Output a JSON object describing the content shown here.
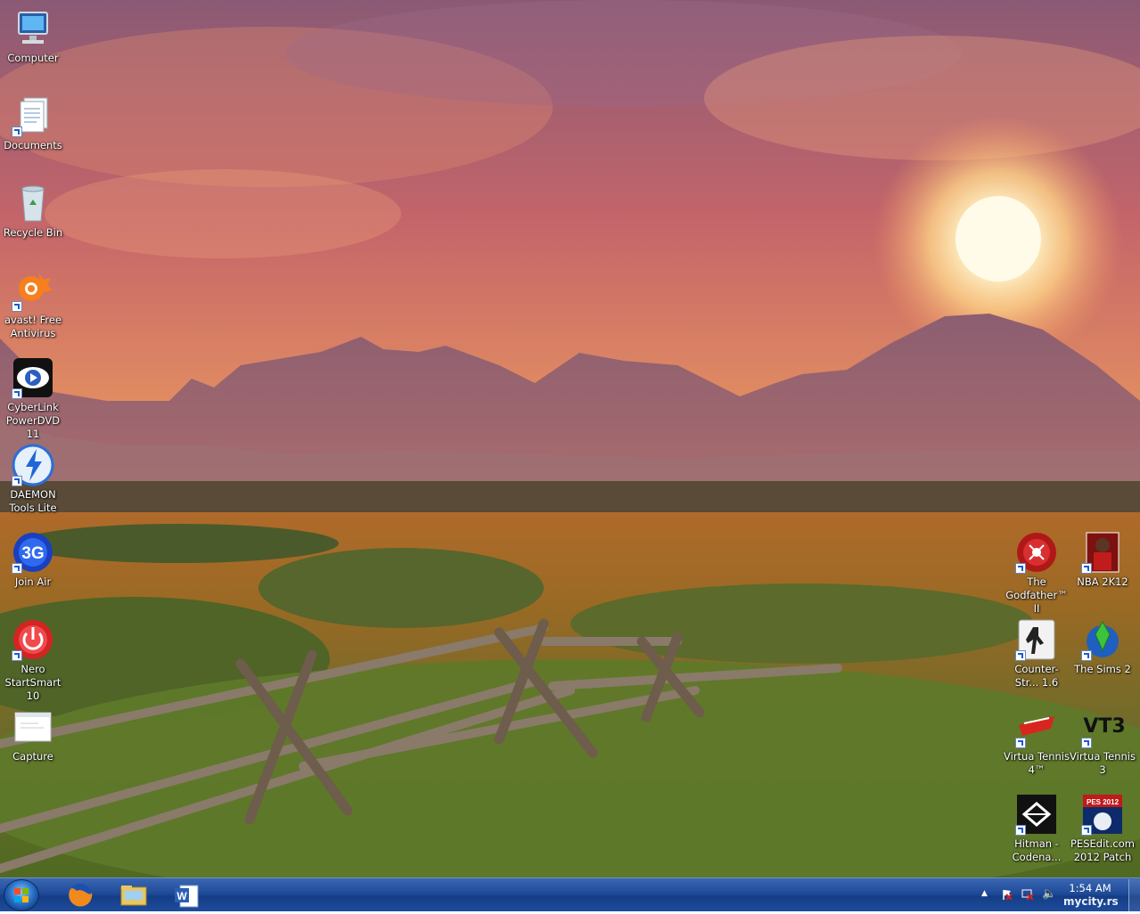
{
  "desktop_icons_left": [
    {
      "label": "Computer",
      "icon": "computer-icon"
    },
    {
      "label": "Documents",
      "icon": "documents-icon"
    },
    {
      "label": "Recycle Bin",
      "icon": "recycle-bin-icon"
    },
    {
      "label": "avast! Free Antivirus",
      "icon": "avast-icon"
    },
    {
      "label": "CyberLink PowerDVD 11",
      "icon": "powerdvd-icon"
    },
    {
      "label": "DAEMON Tools Lite",
      "icon": "daemon-tools-icon"
    },
    {
      "label": "Join Air",
      "icon": "join-air-icon"
    },
    {
      "label": "Nero StartSmart 10",
      "icon": "nero-icon"
    },
    {
      "label": "Capture",
      "icon": "capture-icon"
    }
  ],
  "desktop_icons_right": [
    {
      "label": "The Godfather™ II",
      "icon": "godfather-icon"
    },
    {
      "label": "NBA 2K12",
      "icon": "nba-2k12-icon"
    },
    {
      "label": "Counter-Str... 1.6",
      "icon": "counter-strike-icon"
    },
    {
      "label": "The Sims 2",
      "icon": "sims-2-icon"
    },
    {
      "label": "Virtua Tennis 4™",
      "icon": "virtua-tennis-4-icon"
    },
    {
      "label": "Virtua Tennis 3",
      "icon": "virtua-tennis-3-icon"
    },
    {
      "label": "Hitman - Codena...",
      "icon": "hitman-icon"
    },
    {
      "label": "PESEdit.com 2012 Patch",
      "icon": "pes-2012-icon"
    }
  ],
  "icon_text": {
    "vt3": "VT3",
    "join_air": "3G",
    "pes": "PES 2012"
  },
  "taskbar": {
    "pinned": [
      {
        "name": "firefox-icon"
      },
      {
        "name": "windows-explorer-icon"
      },
      {
        "name": "microsoft-word-icon"
      }
    ],
    "clock_time": "1:54 AM",
    "watermark": "mycity.rs"
  },
  "colors": {
    "taskbar": "#1f4b98",
    "label_text": "#ffffff"
  }
}
